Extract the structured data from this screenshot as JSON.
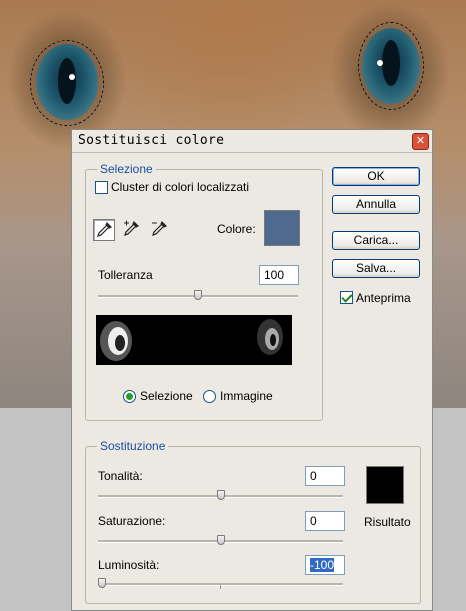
{
  "dialog": {
    "title": "Sostituisci colore",
    "close_icon": "close-icon"
  },
  "selezione": {
    "legend": "Selezione",
    "cluster_label": "Cluster di colori localizzati",
    "cluster_checked": false,
    "tools": [
      "eyedropper-icon",
      "eyedropper-plus-icon",
      "eyedropper-minus-icon"
    ],
    "colore_label": "Colore:",
    "colore_hex": "#4f6a8c",
    "tolleranza_label": "Tolleranza",
    "tolleranza_value": "100",
    "tolleranza_slider": 0.5,
    "radio_selezione": "Selezione",
    "radio_immagine": "Immagine",
    "radio_selected": "Selezione"
  },
  "buttons": {
    "ok": "OK",
    "annulla": "Annulla",
    "carica": "Carica...",
    "salva": "Salva..."
  },
  "anteprima": {
    "label": "Anteprima",
    "checked": true
  },
  "sostituzione": {
    "legend": "Sostituzione",
    "tonalita_label": "Tonalità:",
    "tonalita_value": "0",
    "tonalita_slider": 0.5,
    "saturazione_label": "Saturazione:",
    "saturazione_value": "0",
    "saturazione_slider": 0.5,
    "luminosita_label": "Luminosità:",
    "luminosita_value": "-100",
    "luminosita_slider": 0.0,
    "risultato_label": "Risultato",
    "risultato_hex": "#000000"
  },
  "colors": {
    "legend_blue": "#1a4fa0",
    "dialog_bg": "#ece9e3",
    "check_green": "#1a8a1a"
  }
}
